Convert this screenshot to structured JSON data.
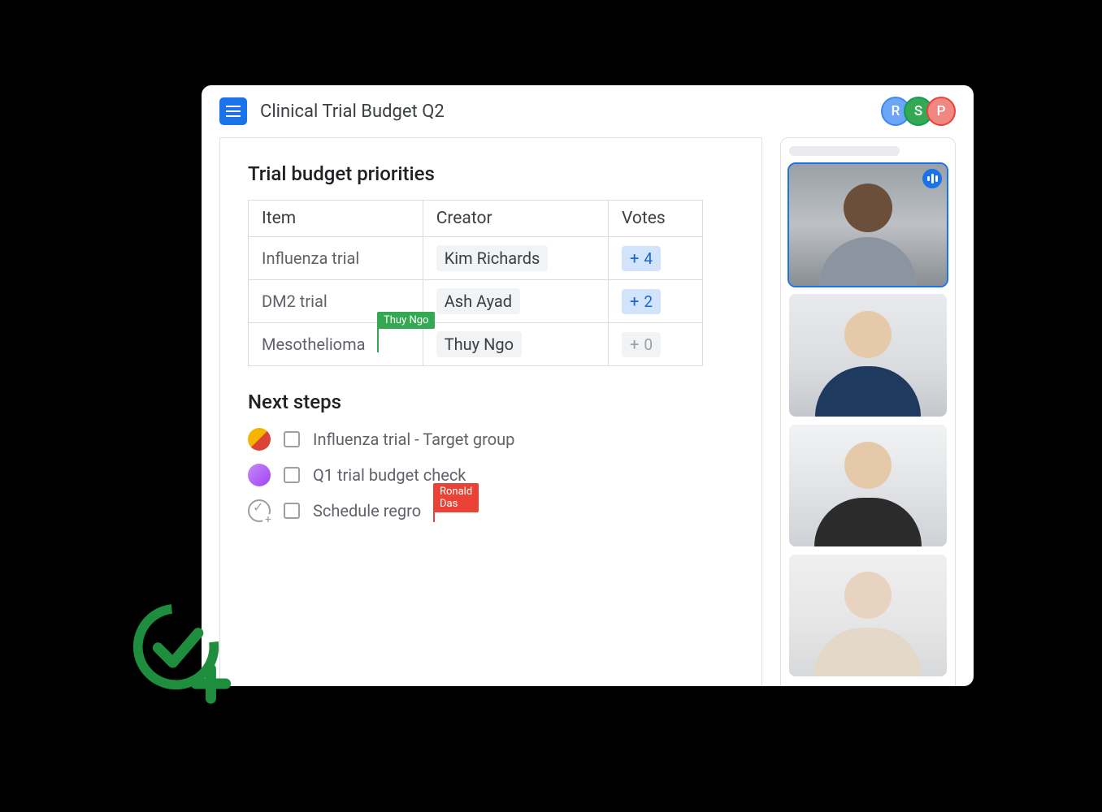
{
  "header": {
    "doc_title": "Clinical Trial Budget Q2",
    "collaborators": [
      {
        "initial": "R",
        "color": "blue"
      },
      {
        "initial": "S",
        "color": "green"
      },
      {
        "initial": "P",
        "color": "red"
      }
    ]
  },
  "sections": {
    "priorities_title": "Trial budget priorities",
    "next_steps_title": "Next steps"
  },
  "priorities_table": {
    "headers": {
      "item": "Item",
      "creator": "Creator",
      "votes": "Votes"
    },
    "rows": [
      {
        "item": "Influenza trial",
        "creator": "Kim Richards",
        "votes": 4,
        "votes_enabled": true
      },
      {
        "item": "DM2 trial",
        "creator": "Ash Ayad",
        "votes": 2,
        "votes_enabled": true
      },
      {
        "item": "Mesothelioma",
        "creator": "Thuy Ngo",
        "votes": 0,
        "votes_enabled": false,
        "live_cursor": {
          "user": "Thuy Ngo",
          "color": "green"
        }
      }
    ]
  },
  "next_steps": [
    {
      "label": "Influenza trial - Target group",
      "checked": false,
      "assignee_type": "group"
    },
    {
      "label": "Q1 trial budget check",
      "checked": false,
      "assignee_type": "single"
    },
    {
      "label": "Schedule regro",
      "checked": false,
      "assignee_type": "add",
      "live_cursor": {
        "user": "Ronald Das",
        "color": "red"
      }
    }
  ],
  "meet_panel": {
    "participants_count": 4,
    "active_speaker_index": 0,
    "controls": {
      "mic": "mic-icon",
      "camera": "camera-icon",
      "more": "more-icon",
      "hangup": "hangup-icon"
    }
  },
  "decorative": {
    "check_add_icon": "check-add-icon"
  }
}
